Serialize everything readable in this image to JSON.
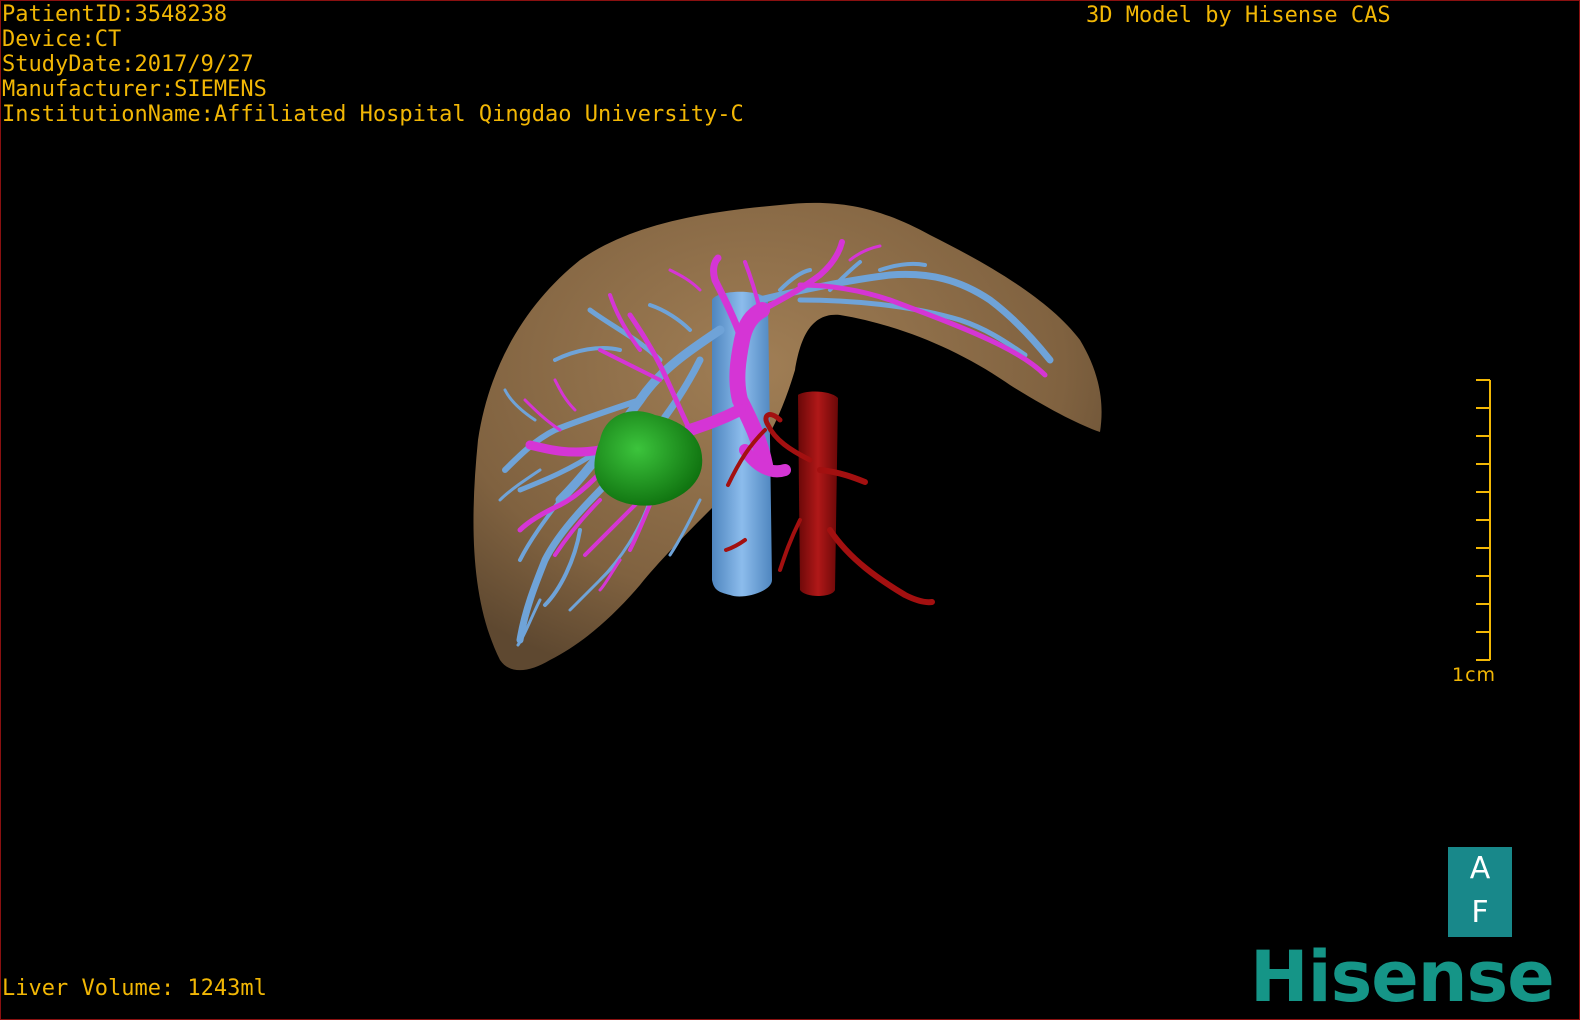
{
  "patient_info": {
    "patient_id": "PatientID:3548238",
    "device": "Device:CT",
    "study_date": "StudyDate:2017/9/27",
    "manufacturer": "Manufacturer:SIEMENS",
    "institution": "InstitutionName:Affiliated Hospital Qingdao University-C"
  },
  "credit": "3D Model by Hisense CAS",
  "liver_volume": "Liver Volume: 1243ml",
  "scale_bar": {
    "label": "1cm",
    "tick_count": 11
  },
  "orientation_cube": {
    "top": "A",
    "bottom": "F"
  },
  "brand_logo": "Hisense",
  "colors": {
    "overlay_text": "#f2b705",
    "liver": "#8a6a45",
    "hepatic_vein": "#6fa3d8",
    "portal_vein": "#d535d5",
    "artery_aorta": "#9a0f0f",
    "tumor": "#1a8a1a",
    "orientation_cube": "#18888a",
    "brand": "#159587",
    "frame_border": "#8a1010"
  },
  "model_structures": [
    "liver",
    "inferior-vena-cava",
    "hepatic-veins",
    "portal-vein",
    "aorta",
    "hepatic-artery",
    "tumor"
  ]
}
